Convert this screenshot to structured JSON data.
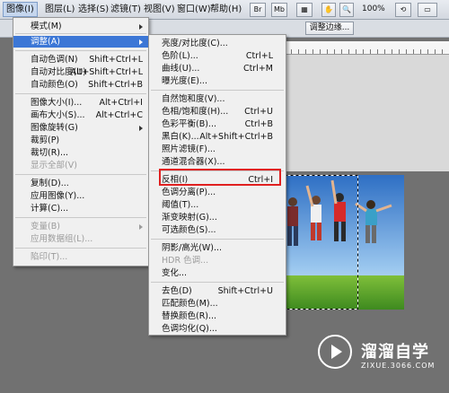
{
  "menubar": {
    "items": [
      {
        "label": "图像(I)",
        "active": true
      },
      {
        "label": "图层(L)"
      },
      {
        "label": "选择(S)"
      },
      {
        "label": "滤镜(T)"
      },
      {
        "label": "视图(V)"
      },
      {
        "label": "窗口(W)"
      },
      {
        "label": "帮助(H)"
      }
    ],
    "br_label": "Br",
    "mb_label": "Mb",
    "zoom": "100%"
  },
  "options": {
    "adjust_edge": "调整边缘..."
  },
  "image_menu": {
    "items": [
      {
        "label": "模式(M)",
        "shortcut": "",
        "submenu": true
      },
      {
        "label": "调整(A)",
        "shortcut": "",
        "submenu": true,
        "highlight": true
      },
      {
        "label": "自动色调(N)",
        "shortcut": "Shift+Ctrl+L"
      },
      {
        "label": "自动对比度(U)",
        "shortcut": "Alt+Shift+Ctrl+L"
      },
      {
        "label": "自动颜色(O)",
        "shortcut": "Shift+Ctrl+B"
      },
      {
        "label": "图像大小(I)...",
        "shortcut": "Alt+Ctrl+I"
      },
      {
        "label": "画布大小(S)...",
        "shortcut": "Alt+Ctrl+C"
      },
      {
        "label": "图像旋转(G)",
        "shortcut": "",
        "submenu": true
      },
      {
        "label": "裁剪(P)",
        "shortcut": ""
      },
      {
        "label": "裁切(R)...",
        "shortcut": ""
      },
      {
        "label": "显示全部(V)",
        "shortcut": "",
        "disabled": true
      },
      {
        "label": "复制(D)...",
        "shortcut": ""
      },
      {
        "label": "应用图像(Y)...",
        "shortcut": ""
      },
      {
        "label": "计算(C)...",
        "shortcut": ""
      },
      {
        "label": "变量(B)",
        "shortcut": "",
        "submenu": true,
        "disabled": true
      },
      {
        "label": "应用数据组(L)...",
        "shortcut": "",
        "disabled": true
      },
      {
        "label": "陷印(T)...",
        "shortcut": "",
        "disabled": true
      }
    ]
  },
  "adjust_menu": {
    "items": [
      {
        "label": "亮度/对比度(C)...",
        "shortcut": ""
      },
      {
        "label": "色阶(L)...",
        "shortcut": "Ctrl+L"
      },
      {
        "label": "曲线(U)...",
        "shortcut": "Ctrl+M"
      },
      {
        "label": "曝光度(E)...",
        "shortcut": ""
      },
      {
        "label": "自然饱和度(V)...",
        "shortcut": ""
      },
      {
        "label": "色相/饱和度(H)...",
        "shortcut": "Ctrl+U"
      },
      {
        "label": "色彩平衡(B)...",
        "shortcut": "Ctrl+B"
      },
      {
        "label": "黑白(K)...",
        "shortcut": "Alt+Shift+Ctrl+B"
      },
      {
        "label": "照片滤镜(F)...",
        "shortcut": ""
      },
      {
        "label": "通道混合器(X)...",
        "shortcut": ""
      },
      {
        "label": "反相(I)",
        "shortcut": "Ctrl+I"
      },
      {
        "label": "色调分离(P)...",
        "shortcut": ""
      },
      {
        "label": "阈值(T)...",
        "shortcut": ""
      },
      {
        "label": "渐变映射(G)...",
        "shortcut": ""
      },
      {
        "label": "可选颜色(S)...",
        "shortcut": ""
      },
      {
        "label": "阴影/高光(W)...",
        "shortcut": ""
      },
      {
        "label": "HDR 色调...",
        "shortcut": "",
        "disabled": true
      },
      {
        "label": "变化...",
        "shortcut": ""
      },
      {
        "label": "去色(D)",
        "shortcut": "Shift+Ctrl+U"
      },
      {
        "label": "匹配颜色(M)...",
        "shortcut": ""
      },
      {
        "label": "替换颜色(R)...",
        "shortcut": ""
      },
      {
        "label": "色调均化(Q)...",
        "shortcut": ""
      }
    ]
  },
  "watermark": {
    "title": "溜溜自学",
    "url": "ZIXUE.3066.COM"
  },
  "colors": {
    "highlight": "#3c77d6",
    "callout": "#e02020"
  }
}
